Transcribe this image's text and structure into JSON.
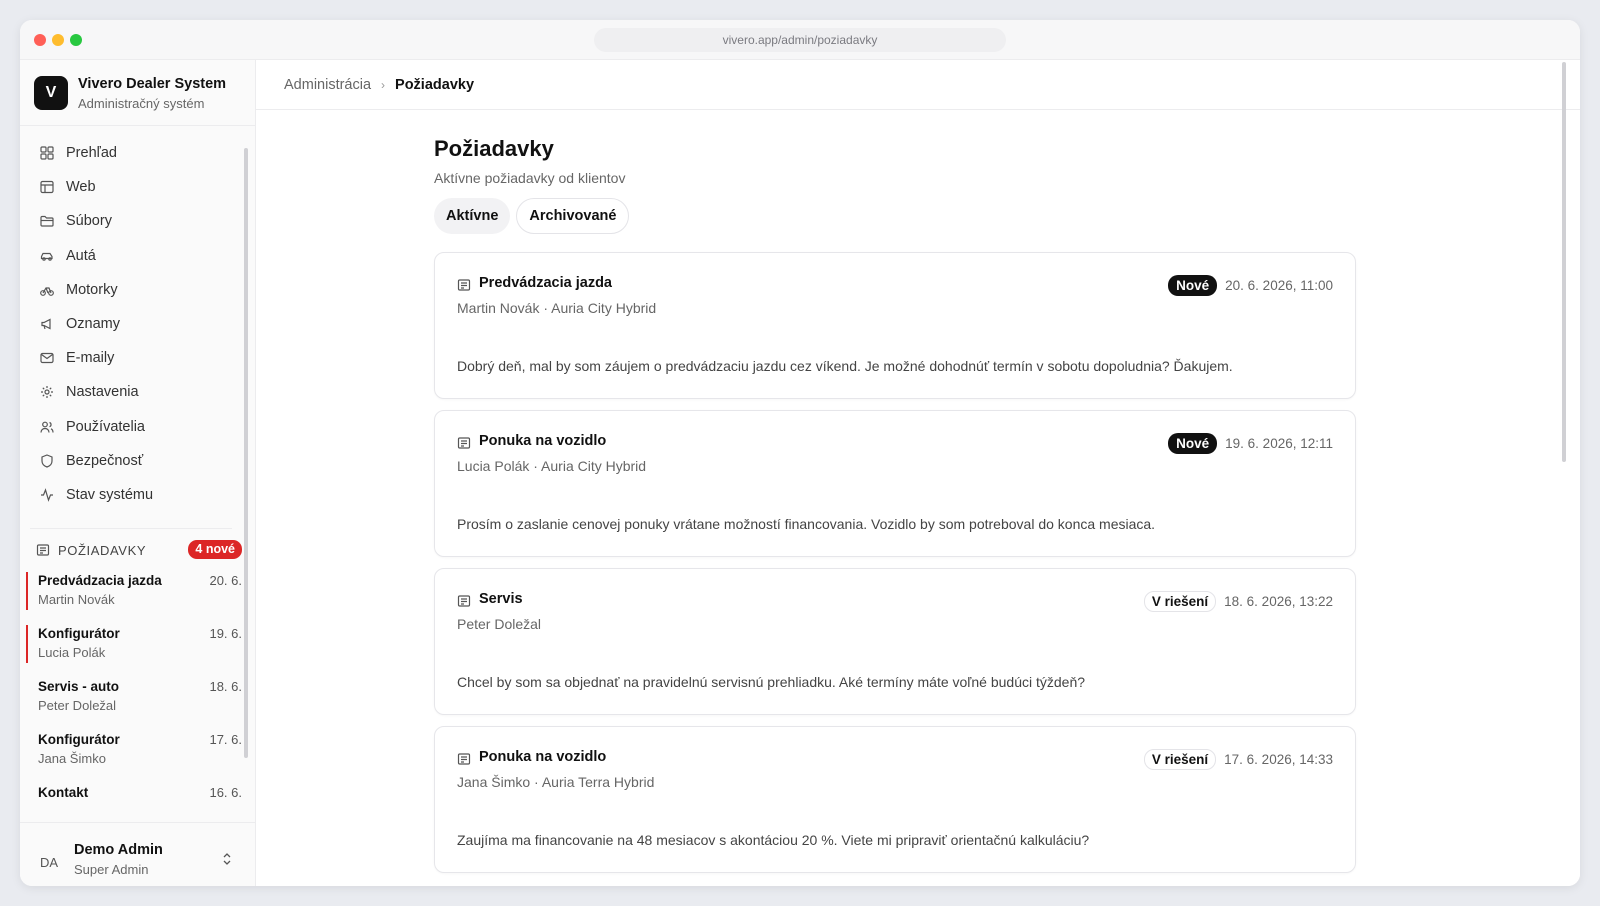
{
  "browser": {
    "url": "vivero.app/admin/poziadavky"
  },
  "brand": {
    "logo": "V",
    "name": "Vivero Dealer System",
    "subtitle": "Administračný systém"
  },
  "nav": [
    {
      "label": "Prehľad",
      "icon": "grid-icon"
    },
    {
      "label": "Web",
      "icon": "layout-icon"
    },
    {
      "label": "Súbory",
      "icon": "folder-icon"
    },
    {
      "label": "Autá",
      "icon": "car-icon"
    },
    {
      "label": "Motorky",
      "icon": "bike-icon"
    },
    {
      "label": "Oznamy",
      "icon": "megaphone-icon"
    },
    {
      "label": "E-maily",
      "icon": "mail-icon"
    },
    {
      "label": "Nastavenia",
      "icon": "gear-icon"
    },
    {
      "label": "Používatelia",
      "icon": "users-icon"
    },
    {
      "label": "Bezpečnosť",
      "icon": "shield-icon"
    },
    {
      "label": "Stav systému",
      "icon": "activity-icon"
    }
  ],
  "requests_panel": {
    "title": "Požiadavky",
    "badge": "4 nové",
    "items": [
      {
        "title": "Predvádzacia jazda",
        "date": "20. 6.",
        "name": "Martin Novák",
        "unread": true
      },
      {
        "title": "Konfigurátor",
        "date": "19. 6.",
        "name": "Lucia Polák",
        "unread": true
      },
      {
        "title": "Servis - auto",
        "date": "18. 6.",
        "name": "Peter Doležal",
        "unread": false
      },
      {
        "title": "Konfigurátor",
        "date": "17. 6.",
        "name": "Jana Šimko",
        "unread": false
      },
      {
        "title": "Kontakt",
        "date": "16. 6.",
        "name": "",
        "unread": false
      }
    ]
  },
  "user": {
    "initials": "DA",
    "name": "Demo Admin",
    "role": "Super Admin"
  },
  "breadcrumb": {
    "parent": "Administrácia",
    "current": "Požiadavky"
  },
  "page": {
    "title": "Požiadavky",
    "subtitle": "Aktívne požiadavky od klientov",
    "tabs": [
      {
        "label": "Aktívne",
        "active": true
      },
      {
        "label": "Archivované",
        "active": false
      }
    ]
  },
  "cards": [
    {
      "title": "Predvádzacia jazda",
      "meta": "Martin Novák · Auria City Hybrid",
      "status": "Nové",
      "status_type": "new",
      "date": "20. 6. 2026, 11:00",
      "body": "Dobrý deň, mal by som záujem o predvádzaciu jazdu cez víkend. Je možné dohodnúť termín v sobotu dopoludnia? Ďakujem."
    },
    {
      "title": "Ponuka na vozidlo",
      "meta": "Lucia Polák · Auria City Hybrid",
      "status": "Nové",
      "status_type": "new",
      "date": "19. 6. 2026, 12:11",
      "body": "Prosím o zaslanie cenovej ponuky vrátane možností financovania. Vozidlo by som potreboval do konca mesiaca."
    },
    {
      "title": "Servis",
      "meta": "Peter Doležal",
      "status": "V riešení",
      "status_type": "progress",
      "date": "18. 6. 2026, 13:22",
      "body": "Chcel by som sa objednať na pravidelnú servisnú prehliadku. Aké termíny máte voľné budúci týždeň?"
    },
    {
      "title": "Ponuka na vozidlo",
      "meta": "Jana Šimko · Auria Terra Hybrid",
      "status": "V riešení",
      "status_type": "progress",
      "date": "17. 6. 2026, 14:33",
      "body": "Zaujíma ma financovanie na 48 mesiacov s akontáciou 20 %. Viete mi pripraviť orientačnú kalkuláciu?"
    }
  ]
}
